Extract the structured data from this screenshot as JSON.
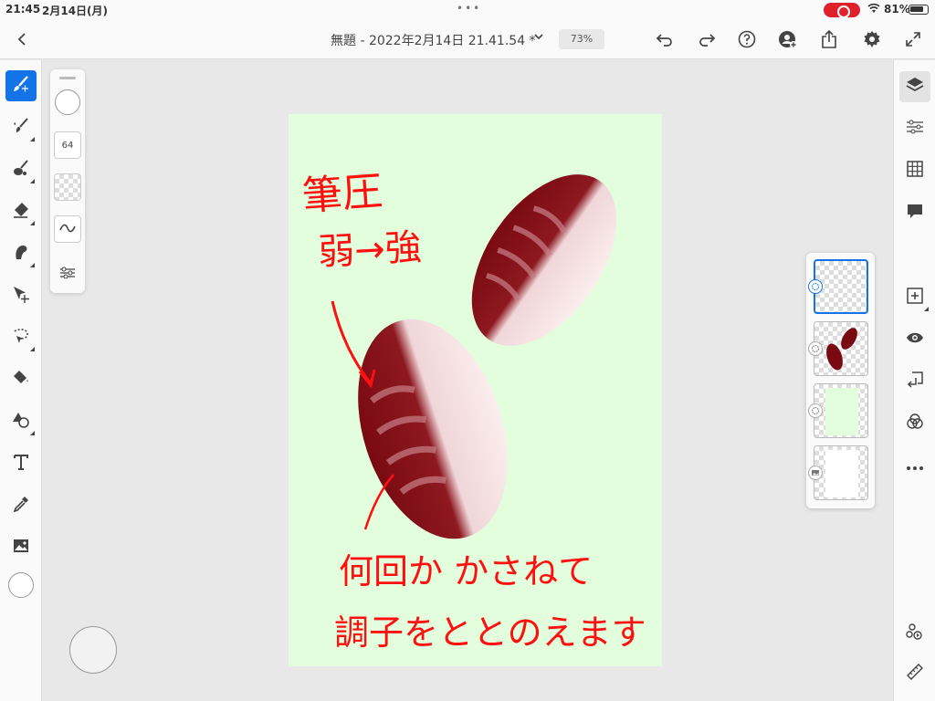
{
  "status_bar": {
    "time": "21:45",
    "date": "2月14日(月)",
    "battery": "81%",
    "battery_level": 0.81,
    "wifi_icon": "wifi-icon",
    "recording_icon": "screen-recording-icon"
  },
  "toolbar": {
    "back_icon": "chevron-left-icon",
    "title": "無題 - 2022年2月14日 21.41.54 *",
    "title_menu_icon": "chevron-down-icon",
    "zoom": "73%",
    "undo_icon": "undo-icon",
    "redo_icon": "redo-icon",
    "help_icon": "help-icon",
    "invite_icon": "invite-user-icon",
    "share_icon": "share-icon",
    "settings_icon": "gear-icon",
    "fullscreen_icon": "fullscreen-icon"
  },
  "left_tools": [
    {
      "name": "paint-brush-tool",
      "icon": "paint-brush-icon",
      "active": true
    },
    {
      "name": "watercolor-brush-tool",
      "icon": "watercolor-brush-icon",
      "active": false
    },
    {
      "name": "oil-brush-tool",
      "icon": "oil-brush-icon",
      "active": false
    },
    {
      "name": "eraser-tool",
      "icon": "eraser-icon",
      "active": false
    },
    {
      "name": "smudge-tool",
      "icon": "smudge-icon",
      "active": false
    },
    {
      "name": "move-tool",
      "icon": "move-icon",
      "active": false
    },
    {
      "name": "lasso-tool",
      "icon": "lasso-icon",
      "active": false
    },
    {
      "name": "fill-tool",
      "icon": "paint-bucket-icon",
      "active": false
    },
    {
      "name": "shape-tool",
      "icon": "shapes-icon",
      "active": false
    },
    {
      "name": "type-tool",
      "icon": "text-icon",
      "active": false
    },
    {
      "name": "eyedropper-tool",
      "icon": "eyedropper-icon",
      "active": false
    },
    {
      "name": "place-image-tool",
      "icon": "image-icon",
      "active": false
    }
  ],
  "brush_panel": {
    "size_value": "64",
    "opacity_icon": "checkerboard-icon",
    "smoothing_icon": "smoothing-wave-icon",
    "settings_icon": "brush-settings-icon"
  },
  "canvas": {
    "background_color": "#e2fedc",
    "annotations": {
      "line1": "筆圧",
      "line2": "弱→強",
      "line3": "何回か かさねて",
      "line4": "調子をととのえます"
    },
    "stroke_color": "#ff0f0f"
  },
  "right_tools": [
    {
      "name": "layers-button",
      "icon": "layers-icon",
      "active": true
    },
    {
      "name": "adjustments-button",
      "icon": "sliders-icon",
      "active": false
    },
    {
      "name": "grid-button",
      "icon": "grid-icon",
      "active": false
    },
    {
      "name": "comments-button",
      "icon": "comment-icon",
      "active": false
    },
    {
      "name": "add-layer-button",
      "icon": "add-layer-icon",
      "active": false
    },
    {
      "name": "visibility-button",
      "icon": "eye-icon",
      "active": false
    },
    {
      "name": "merge-down-button",
      "icon": "merge-icon",
      "active": false
    },
    {
      "name": "blend-mode-button",
      "icon": "blend-circles-icon",
      "active": false
    },
    {
      "name": "more-button",
      "icon": "ellipsis-icon",
      "active": false
    },
    {
      "name": "live-stream-button",
      "icon": "broadcast-icon",
      "active": false
    },
    {
      "name": "ruler-button",
      "icon": "ruler-icon",
      "active": false
    }
  ],
  "layers": [
    {
      "name": "layer-empty",
      "selected": true,
      "type": "pixel"
    },
    {
      "name": "layer-sushi",
      "selected": false,
      "type": "pixel"
    },
    {
      "name": "layer-green-bg",
      "selected": false,
      "type": "pixel"
    },
    {
      "name": "layer-white-bg",
      "selected": false,
      "type": "image"
    }
  ]
}
